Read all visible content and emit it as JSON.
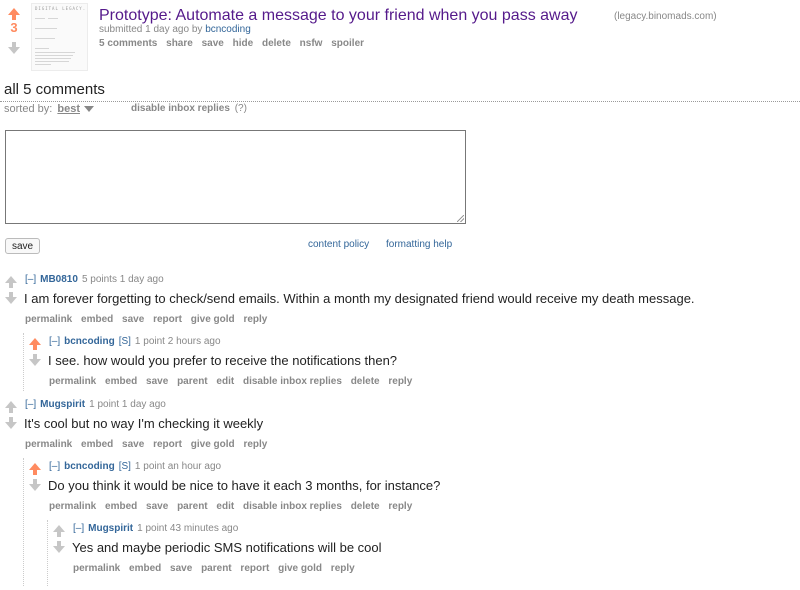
{
  "post": {
    "score": "3",
    "title": "Prototype: Automate a message to your friend when you pass away",
    "domain": "(legacy.binomads.com)",
    "submitted_prefix": "submitted 1 day ago by",
    "author": "bcncoding",
    "thumbnail_text": "DIGITAL LEGACY.",
    "buttons": [
      "5 comments",
      "share",
      "save",
      "hide",
      "delete",
      "nsfw",
      "spoiler"
    ]
  },
  "comments_header": {
    "title": "all 5 comments",
    "sorted_label": "sorted by:",
    "sorted_value": "best",
    "disable_inbox": "disable inbox replies",
    "help": "(?)"
  },
  "reply_form": {
    "text": "",
    "save_label": "save",
    "content_policy": "content policy",
    "formatting_help": "formatting help"
  },
  "comments": [
    {
      "expand": "[–]",
      "author": "MB0810",
      "submitter": "",
      "meta": "5 points 1 day ago",
      "body": "I am forever forgetting to check/send emails. Within a month my designated friend would receive my death message.",
      "buttons": [
        "permalink",
        "embed",
        "save",
        "report",
        "give gold",
        "reply"
      ],
      "upvoted": false
    },
    {
      "expand": "[–]",
      "author": "bcncoding",
      "submitter": "[S]",
      "meta": "1 point 2 hours ago",
      "body": "I see. how would you prefer to receive the notifications then?",
      "buttons": [
        "permalink",
        "embed",
        "save",
        "parent",
        "edit",
        "disable inbox replies",
        "delete",
        "reply"
      ],
      "upvoted": true
    },
    {
      "expand": "[–]",
      "author": "Mugspirit",
      "submitter": "",
      "meta": "1 point 1 day ago",
      "body": "It's cool but no way I'm checking it weekly",
      "buttons": [
        "permalink",
        "embed",
        "save",
        "report",
        "give gold",
        "reply"
      ],
      "upvoted": false
    },
    {
      "expand": "[–]",
      "author": "bcncoding",
      "submitter": "[S]",
      "meta": "1 point an hour ago",
      "body": "Do you think it would be nice to have it each 3 months, for instance?",
      "buttons": [
        "permalink",
        "embed",
        "save",
        "parent",
        "edit",
        "disable inbox replies",
        "delete",
        "reply"
      ],
      "upvoted": true
    },
    {
      "expand": "[–]",
      "author": "Mugspirit",
      "submitter": "",
      "meta": "1 point 43 minutes ago",
      "body": "Yes and maybe periodic SMS notifications will be cool",
      "buttons": [
        "permalink",
        "embed",
        "save",
        "parent",
        "report",
        "give gold",
        "reply"
      ],
      "upvoted": false
    }
  ],
  "colors": {
    "title": "#551a8b",
    "link": "#336699",
    "upvote": "#ff8b60",
    "neutral_arrow": "#c6c6c6",
    "meta": "#888888"
  }
}
